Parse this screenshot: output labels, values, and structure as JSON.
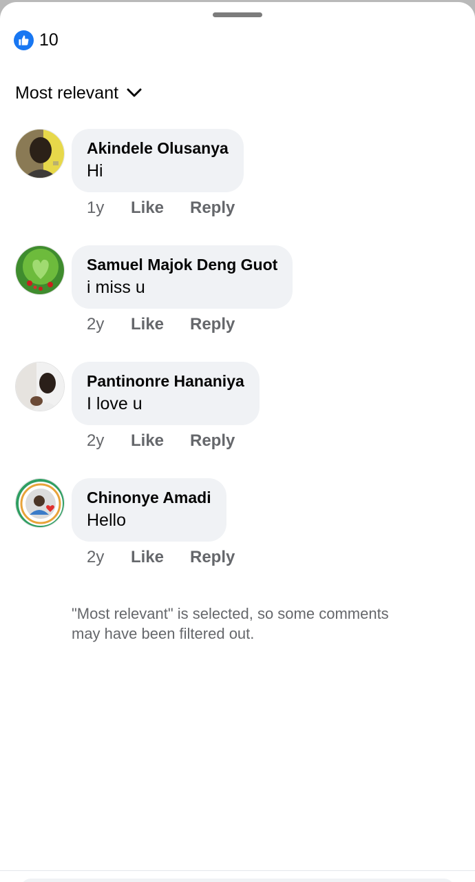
{
  "reactions": {
    "icon": "thumbs-up-icon",
    "count": "10",
    "color": "#1877f2"
  },
  "sort": {
    "label": "Most relevant",
    "icon": "chevron-down-icon"
  },
  "comments": [
    {
      "author": "Akindele Olusanya",
      "text": "Hi",
      "time": "1y",
      "like": "Like",
      "reply": "Reply"
    },
    {
      "author": "Samuel Majok Deng Guot",
      "text": "i miss u",
      "time": "2y",
      "like": "Like",
      "reply": "Reply"
    },
    {
      "author": "Pantinonre Hananiya",
      "text": "I love u",
      "time": "2y",
      "like": "Like",
      "reply": "Reply"
    },
    {
      "author": "Chinonye Amadi",
      "text": "Hello",
      "time": "2y",
      "like": "Like",
      "reply": "Reply"
    }
  ],
  "filter_note": "\"Most relevant\" is selected, so some comments may have been filtered out.",
  "colors": {
    "bubble": "#f0f2f5",
    "secondary_text": "#65676b",
    "primary_text": "#050505"
  }
}
